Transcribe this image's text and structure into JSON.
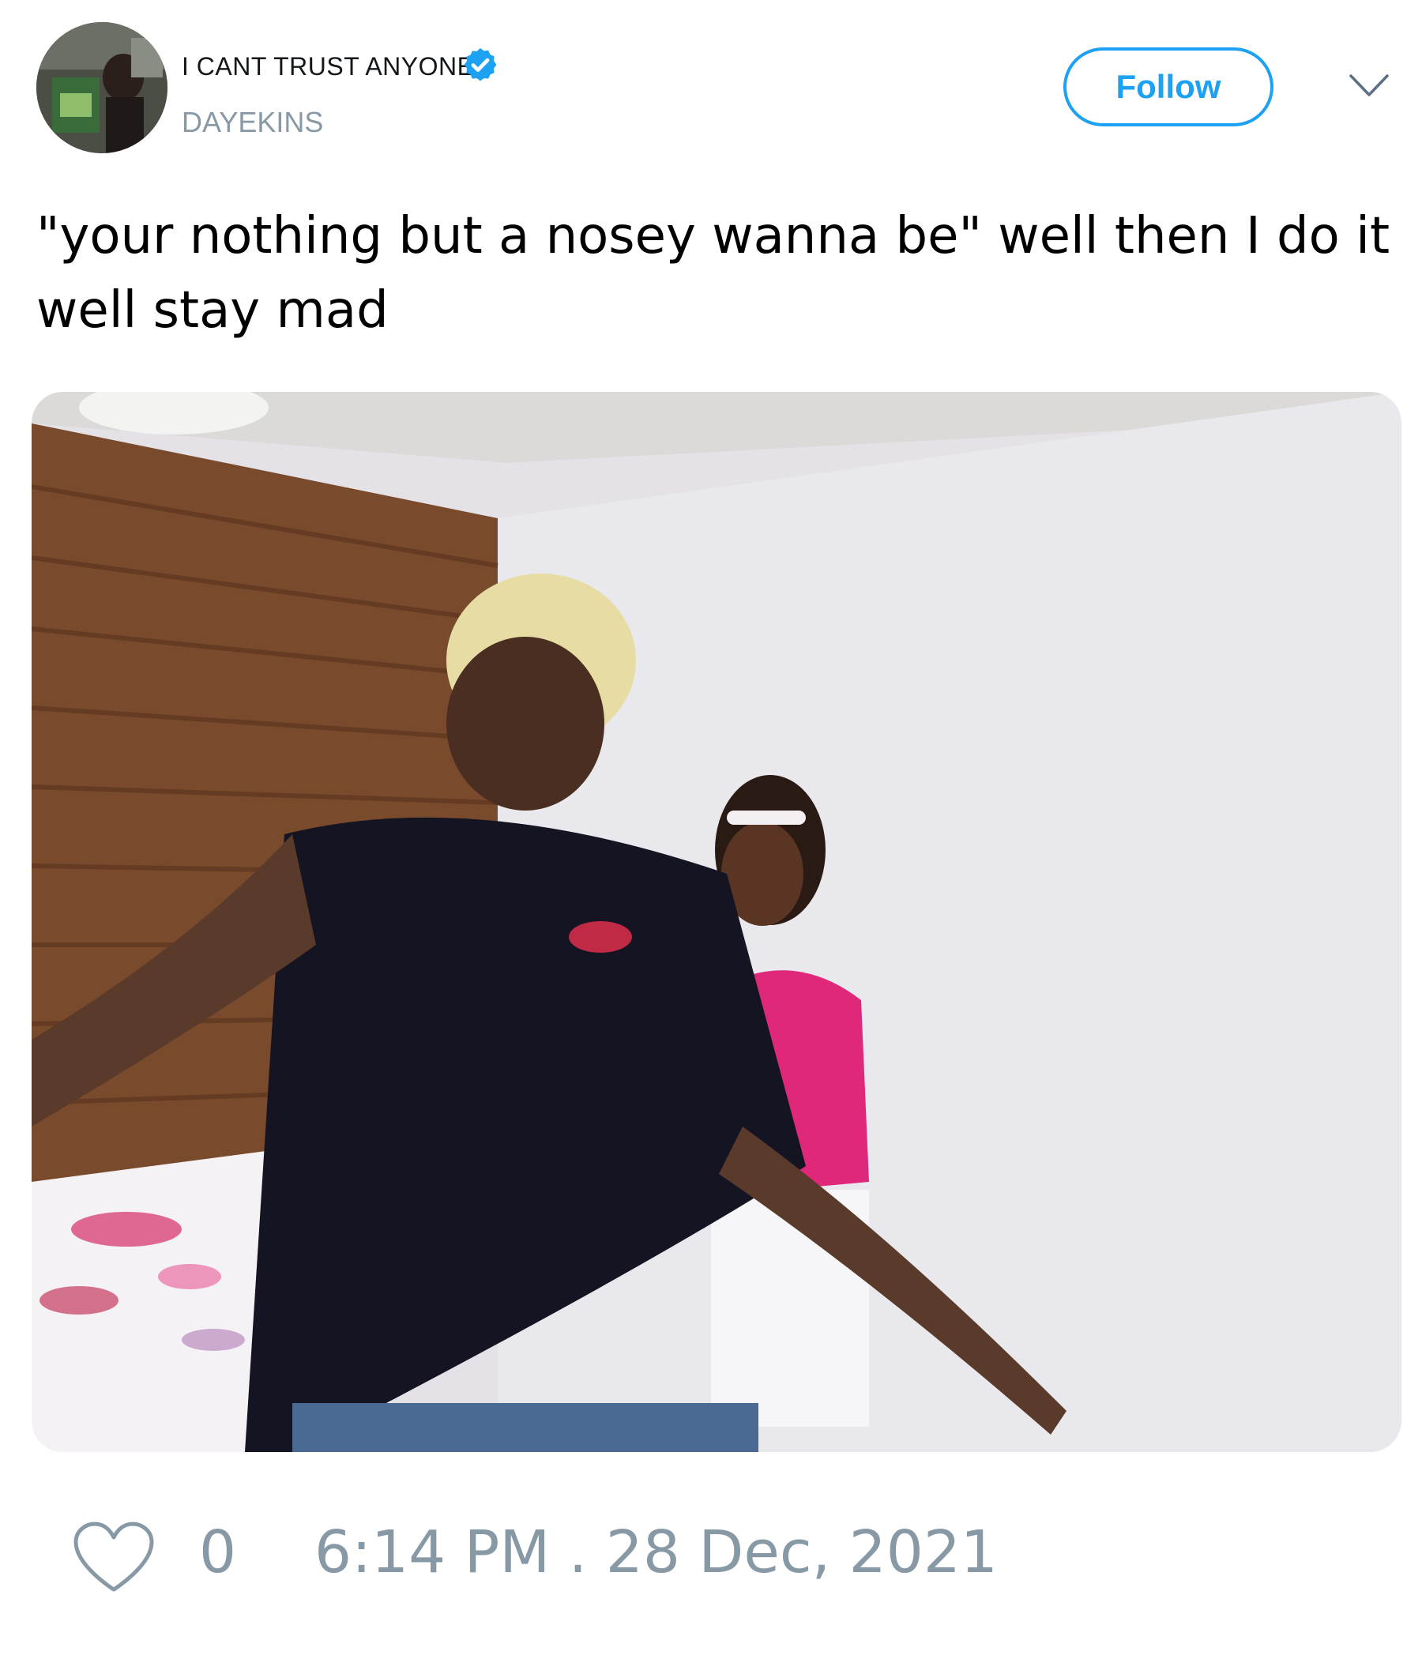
{
  "author": {
    "display_name": "I CANT TRUST ANYONE",
    "handle": "DAYEKINS",
    "verified": true,
    "verified_icon": "verified-badge-icon",
    "avatar_icon": "profile-photo"
  },
  "header": {
    "follow_label": "Follow",
    "menu_icon": "chevron-down-icon"
  },
  "tweet": {
    "text": "\"your nothing but a nosey wanna be\" well then I do it well stay mad",
    "media_icon": "photo-two-women-in-bedroom"
  },
  "footer": {
    "like_icon": "heart-icon",
    "like_count": "0",
    "timestamp": "6:14 PM . 28 Dec, 2021"
  },
  "colors": {
    "accent": "#1da1f2",
    "muted": "#8899a6",
    "text": "#000000"
  }
}
